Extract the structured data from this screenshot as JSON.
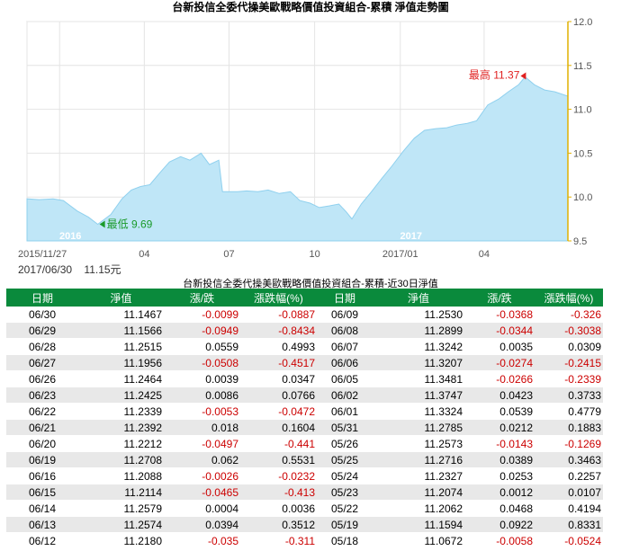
{
  "chart_data": {
    "type": "area",
    "title": "台新投信全委代操美歐戰略價值投資組合-累積 淨值走勢圖",
    "ylim": [
      9.5,
      12.0
    ],
    "y_ticks": [
      "9.5",
      "10.0",
      "10.5",
      "11.0",
      "11.5",
      "12.0"
    ],
    "x_tick_labels": [
      "2015/11/27",
      "2016",
      "04",
      "07",
      "10",
      "2017/01",
      "04"
    ],
    "x_tick_dates": [
      "2015-11-27",
      "2016-01-01",
      "2016-04-01",
      "2016-07-01",
      "2016-10-01",
      "2017-01-01",
      "2017-04-01"
    ],
    "year_markers": [
      "2016",
      "2017"
    ],
    "max_label": "最高 11.37",
    "min_label": "最低 9.69",
    "max_point": {
      "x": "2017-05-15",
      "y": 11.37
    },
    "min_point": {
      "x": "2016-02-11",
      "y": 9.69
    },
    "series": [
      {
        "x": [
          "2015-11-27",
          "2015-12-10",
          "2015-12-25",
          "2016-01-05",
          "2016-01-20",
          "2016-02-01",
          "2016-02-11",
          "2016-02-25",
          "2016-03-08",
          "2016-03-18",
          "2016-03-28",
          "2016-04-07",
          "2016-04-18",
          "2016-04-28",
          "2016-05-10",
          "2016-05-20",
          "2016-06-01",
          "2016-06-10",
          "2016-06-20",
          "2016-06-24",
          "2016-06-30",
          "2016-07-10",
          "2016-07-20",
          "2016-08-01",
          "2016-08-12",
          "2016-08-24",
          "2016-09-05",
          "2016-09-15",
          "2016-09-26",
          "2016-10-06",
          "2016-10-17",
          "2016-10-27",
          "2016-11-04",
          "2016-11-10",
          "2016-11-20",
          "2016-12-01",
          "2016-12-12",
          "2016-12-22",
          "2017-01-04",
          "2017-01-16",
          "2017-01-27",
          "2017-02-08",
          "2017-02-20",
          "2017-03-02",
          "2017-03-14",
          "2017-03-24",
          "2017-04-05",
          "2017-04-17",
          "2017-04-27",
          "2017-05-08",
          "2017-05-15",
          "2017-05-25",
          "2017-06-05",
          "2017-06-16",
          "2017-06-30"
        ],
        "values": [
          9.98,
          9.97,
          9.98,
          9.96,
          9.84,
          9.77,
          9.69,
          9.8,
          9.98,
          10.08,
          10.12,
          10.14,
          10.28,
          10.4,
          10.46,
          10.42,
          10.5,
          10.37,
          10.42,
          10.06,
          10.06,
          10.06,
          10.07,
          10.06,
          10.08,
          10.04,
          10.06,
          9.96,
          9.93,
          9.88,
          9.9,
          9.92,
          9.83,
          9.75,
          9.92,
          10.06,
          10.21,
          10.34,
          10.52,
          10.67,
          10.76,
          10.78,
          10.79,
          10.82,
          10.84,
          10.87,
          11.05,
          11.12,
          11.2,
          11.28,
          11.37,
          11.28,
          11.22,
          11.2,
          11.15
        ]
      }
    ]
  },
  "info": {
    "start_date": "2015/11/27",
    "latest_date": "2017/06/30",
    "latest_nav": "11.15元"
  },
  "table": {
    "title": "台新投信全委代操美歐戰略價值投資組合-累積-近30日淨值",
    "headers": [
      "日期",
      "淨值",
      "漲/跌",
      "漲跌幅(%)",
      "日期",
      "淨值",
      "漲/跌",
      "漲跌幅(%)"
    ],
    "rows": [
      [
        "06/30",
        "11.1467",
        "-0.0099",
        "-0.0887",
        "06/09",
        "11.2530",
        "-0.0368",
        "-0.326"
      ],
      [
        "06/29",
        "11.1566",
        "-0.0949",
        "-0.8434",
        "06/08",
        "11.2899",
        "-0.0344",
        "-0.3038"
      ],
      [
        "06/28",
        "11.2515",
        "0.0559",
        "0.4993",
        "06/07",
        "11.3242",
        "0.0035",
        "0.0309"
      ],
      [
        "06/27",
        "11.1956",
        "-0.0508",
        "-0.4517",
        "06/06",
        "11.3207",
        "-0.0274",
        "-0.2415"
      ],
      [
        "06/26",
        "11.2464",
        "0.0039",
        "0.0347",
        "06/05",
        "11.3481",
        "-0.0266",
        "-0.2339"
      ],
      [
        "06/23",
        "11.2425",
        "0.0086",
        "0.0766",
        "06/02",
        "11.3747",
        "0.0423",
        "0.3733"
      ],
      [
        "06/22",
        "11.2339",
        "-0.0053",
        "-0.0472",
        "06/01",
        "11.3324",
        "0.0539",
        "0.4779"
      ],
      [
        "06/21",
        "11.2392",
        "0.018",
        "0.1604",
        "05/31",
        "11.2785",
        "0.0212",
        "0.1883"
      ],
      [
        "06/20",
        "11.2212",
        "-0.0497",
        "-0.441",
        "05/26",
        "11.2573",
        "-0.0143",
        "-0.1269"
      ],
      [
        "06/19",
        "11.2708",
        "0.062",
        "0.5531",
        "05/25",
        "11.2716",
        "0.0389",
        "0.3463"
      ],
      [
        "06/16",
        "11.2088",
        "-0.0026",
        "-0.0232",
        "05/24",
        "11.2327",
        "0.0253",
        "0.2257"
      ],
      [
        "06/15",
        "11.2114",
        "-0.0465",
        "-0.413",
        "05/23",
        "11.2074",
        "0.0012",
        "0.0107"
      ],
      [
        "06/14",
        "11.2579",
        "0.0004",
        "0.0036",
        "05/22",
        "11.2062",
        "0.0468",
        "0.4194"
      ],
      [
        "06/13",
        "11.2574",
        "0.0394",
        "0.3512",
        "05/19",
        "11.1594",
        "0.0922",
        "0.8331"
      ],
      [
        "06/12",
        "11.2180",
        "-0.035",
        "-0.311",
        "05/18",
        "11.0672",
        "-0.0058",
        "-0.0524"
      ]
    ]
  },
  "colors": {
    "area_fill": "#bfe6f7",
    "area_line": "#8fd0ee",
    "y_axis": "#e0b000",
    "max_marker": "#e02020",
    "min_marker": "#1a9a2a",
    "header_bg": "#0a8a3c",
    "negative": "#cc0000"
  }
}
